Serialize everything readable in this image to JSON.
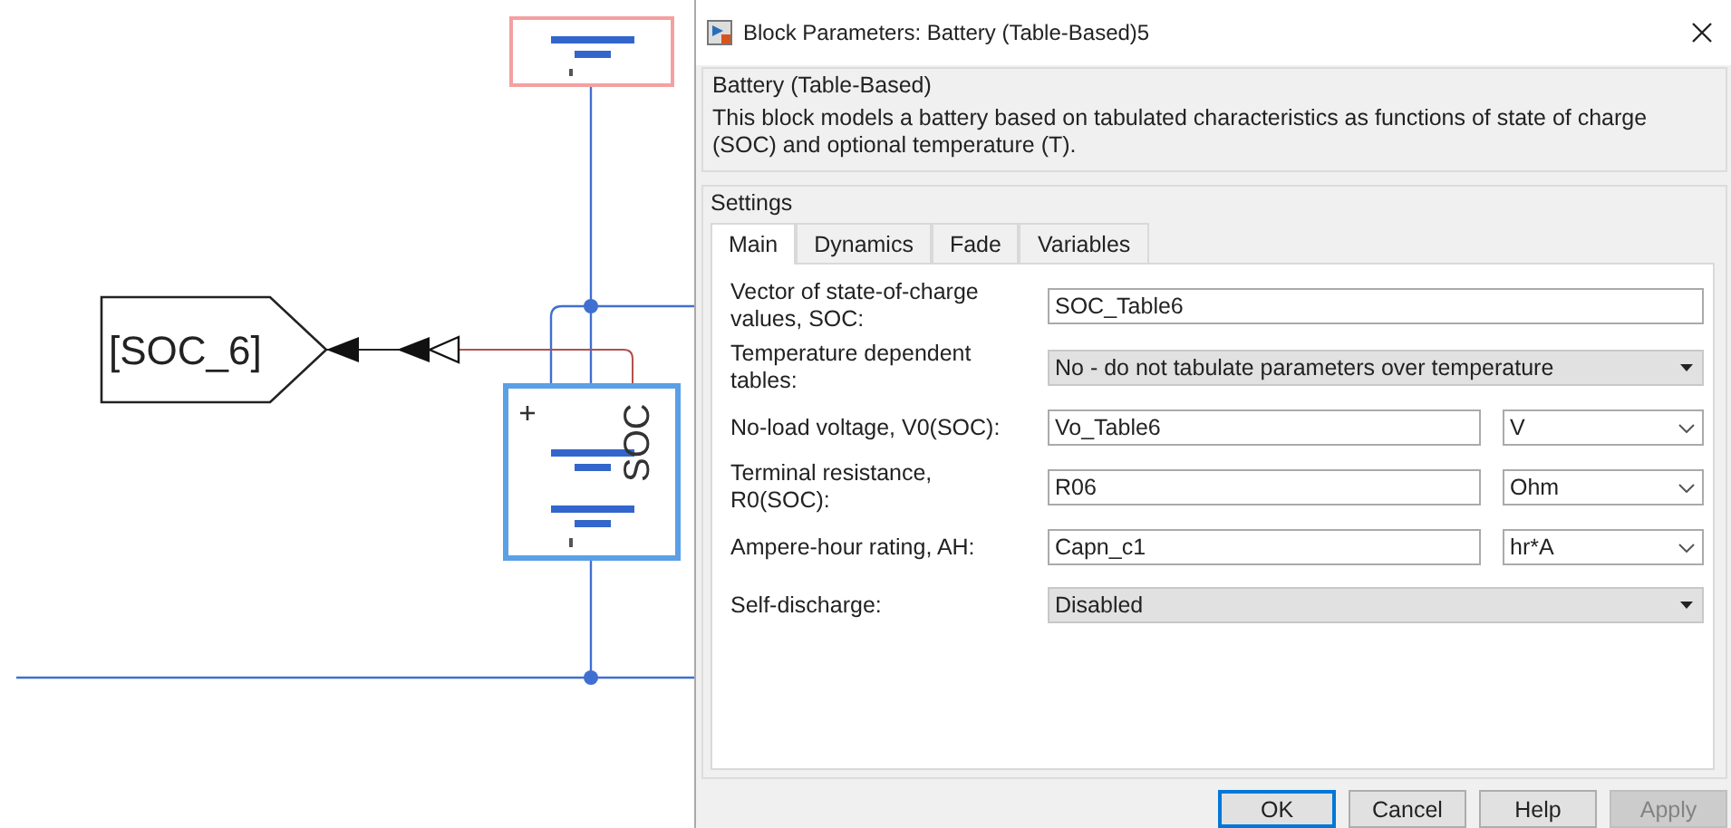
{
  "canvas": {
    "goto_tag": "[SOC_6]",
    "port_label": "SOC"
  },
  "dialog": {
    "title": "Block Parameters: Battery (Table-Based)5",
    "block_name": "Battery (Table-Based)",
    "description": "This block models a battery based on tabulated characteristics as functions of state of charge (SOC) and optional temperature (T).",
    "settings_label": "Settings",
    "tabs": [
      {
        "label": "Main",
        "selected": true
      },
      {
        "label": "Dynamics",
        "selected": false
      },
      {
        "label": "Fade",
        "selected": false
      },
      {
        "label": "Variables",
        "selected": false
      }
    ],
    "parameters": [
      {
        "kind": "text",
        "label": "Vector of state-of-charge values, SOC:",
        "value": "SOC_Table6"
      },
      {
        "kind": "select",
        "label": "Temperature dependent tables:",
        "value": "No - do not tabulate parameters over temperature"
      },
      {
        "kind": "text",
        "label": "No-load voltage, V0(SOC):",
        "value": "Vo_Table6",
        "unit": "V"
      },
      {
        "kind": "text",
        "label": "Terminal resistance, R0(SOC):",
        "value": "R06",
        "unit": "Ohm"
      },
      {
        "kind": "text",
        "label": "Ampere-hour rating, AH:",
        "value": "Capn_c1",
        "unit": "hr*A"
      },
      {
        "kind": "select",
        "label": "Self-discharge:",
        "value": "Disabled"
      }
    ],
    "buttons": [
      {
        "label": "OK",
        "default": true,
        "disabled": false
      },
      {
        "label": "Cancel",
        "default": false,
        "disabled": false
      },
      {
        "label": "Help",
        "default": false,
        "disabled": false
      },
      {
        "label": "Apply",
        "default": false,
        "disabled": true
      }
    ]
  }
}
